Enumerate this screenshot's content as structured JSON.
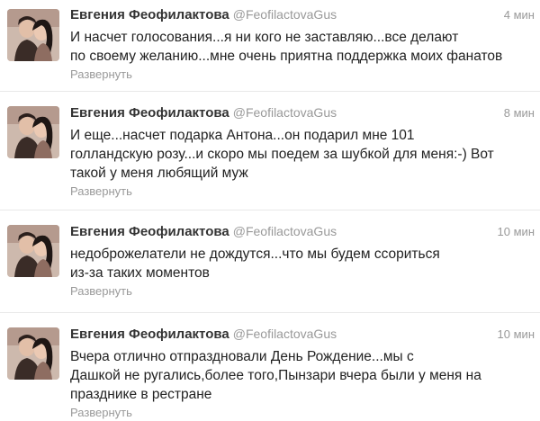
{
  "colors": {
    "name": "#333333",
    "username": "#999999",
    "text": "#222222",
    "divider": "#e8e8e8"
  },
  "tweets": [
    {
      "fullname": "Евгения Феофилактова",
      "username": "@FeofilactovaGus",
      "time": "4 мин",
      "text": "И насчет голосования...я ни кого не заставляю...все делают\nпо своему желанию...мне очень приятна поддержка моих фанатов",
      "expand": "Развернуть"
    },
    {
      "fullname": "Евгения Феофилактова",
      "username": "@FeofilactovaGus",
      "time": "8 мин",
      "text": "И еще...насчет подарка Антона...он подарил мне 101\nголландскую розу...и скоро мы поедем за шубкой для меня:-) Вот\nтакой у меня любящий муж",
      "expand": "Развернуть"
    },
    {
      "fullname": "Евгения Феофилактова",
      "username": "@FeofilactovaGus",
      "time": "10 мин",
      "text": "недоброжелатели не дождутся...что мы будем ссориться\nиз-за таких моментов",
      "expand": "Развернуть"
    },
    {
      "fullname": "Евгения Феофилактова",
      "username": "@FeofilactovaGus",
      "time": "10 мин",
      "text": "Вчера отлично отпраздновали День Рождение...мы с\nДашкой не ругались,более того,Пынзари вчера были у меня на\nпразднике в рестране",
      "expand": "Развернуть"
    }
  ]
}
